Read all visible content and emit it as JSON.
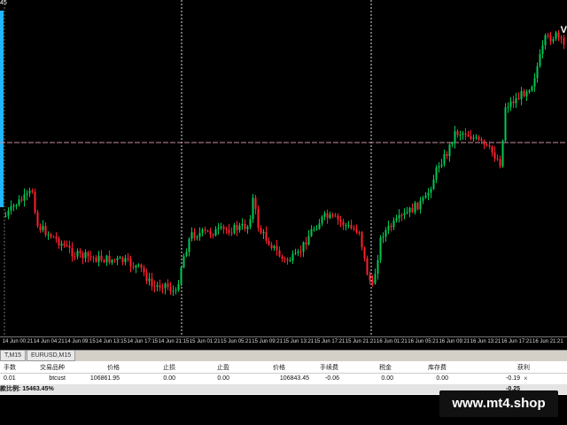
{
  "chart": {
    "corner_label": "45",
    "side_marker": "V",
    "colors": {
      "background": "#000000",
      "bull": "#00c853",
      "bear": "#ff1f2e",
      "grid": "#dddddd",
      "price_line": "#c98b9c",
      "marker_bar": "#1fb6ff"
    },
    "time_labels": [
      "14 Jun 00:21",
      "14 Jun 04:21",
      "14 Jun 09:15",
      "14 Jun 13:15",
      "14 Jun 17:15",
      "14 Jun 21:15",
      "15 Jun 01:21",
      "15 Jun 05:21",
      "15 Jun 09:21",
      "15 Jun 13:21",
      "15 Jun 17:21",
      "15 Jun 21:21",
      "16 Jun 01:21",
      "16 Jun 05:21",
      "16 Jun 09:21",
      "16 Jun 13:21",
      "16 Jun 17:21",
      "16 Jun 21:21"
    ]
  },
  "tabs": [
    "T,M15",
    "EURUSD,M15"
  ],
  "trade_table": {
    "headers": [
      "手数",
      "交易品种",
      "价格",
      "止损",
      "止盈",
      "价格",
      "手续费",
      "税金",
      "库存费",
      "获利"
    ],
    "row": [
      "0.01",
      "btcust",
      "106861.95",
      "0.00",
      "0.00",
      "106843.45",
      "-0.06",
      "0.00",
      "0.00",
      "-0.19"
    ],
    "close_icon": "×",
    "total_label": "款比例: 15463.45%",
    "total_value": "-0.25"
  },
  "watermark": "www.mt4.shop"
}
